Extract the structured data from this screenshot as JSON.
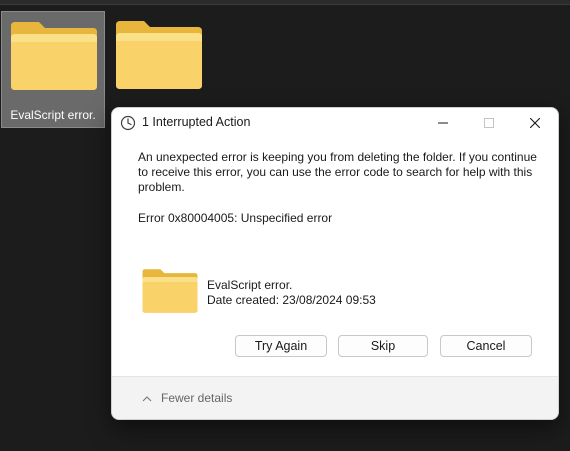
{
  "desktop": {
    "tiles": [
      {
        "label": "EvalScript error.",
        "selected": true
      },
      {
        "label": "",
        "selected": false
      }
    ]
  },
  "dialog": {
    "title": "1 Interrupted Action",
    "message": "An unexpected error is keeping you from deleting the folder. If you continue to receive this error, you can use the error code to search for help with this problem.",
    "error_code": "Error 0x80004005: Unspecified error",
    "item": {
      "name": "EvalScript error.",
      "date_created": "Date created: 23/08/2024 09:53"
    },
    "buttons": {
      "try_again": "Try Again",
      "skip": "Skip",
      "cancel": "Cancel"
    },
    "details_toggle": "Fewer details"
  },
  "colors": {
    "desktop_bg": "#1c1c1c",
    "folder_yellow": "#f7cf57",
    "folder_light": "#fbe08a",
    "selection": "#6a6a6a"
  }
}
